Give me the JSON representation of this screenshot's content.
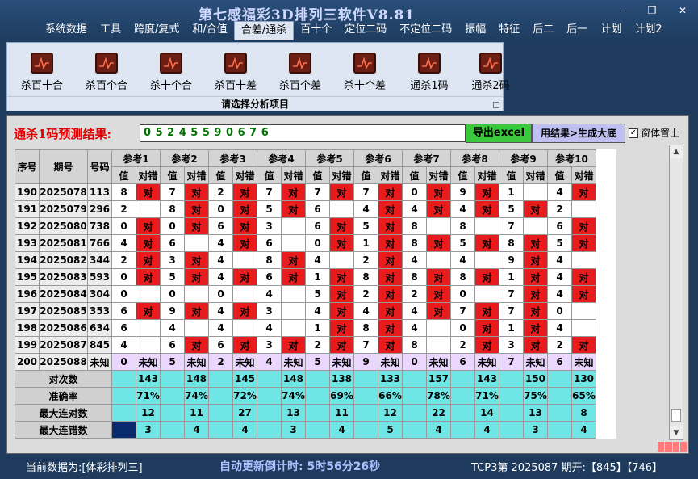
{
  "app": {
    "title": "第七感福彩3D排列三软件V8.81"
  },
  "window_controls": [
    "–",
    "❐",
    "✕"
  ],
  "menu": [
    "系统数据",
    "工具",
    "跨度/复式",
    "和/合值",
    "合差/通杀",
    "百十个",
    "定位二码",
    "不定位二码",
    "振幅",
    "特征",
    "后二",
    "后一",
    "计划",
    "计划2"
  ],
  "menu_active": 4,
  "ribbon": {
    "items": [
      "杀百十合",
      "杀百个合",
      "杀十个合",
      "杀百十差",
      "杀百个差",
      "杀十个差",
      "通杀1码",
      "通杀2码"
    ],
    "caption": "请选择分析项目"
  },
  "prediction": {
    "label": "通杀1码预测结果:",
    "value": "0 5 2 4 5 5 9 0 6 7 6",
    "excel_button": "导出excel",
    "generate_button": "用结果>生成大底",
    "topmost_label": "窗体置上",
    "topmost_checked": "✓"
  },
  "table": {
    "headers": {
      "seq": "序号",
      "period": "期号",
      "code": "号码"
    },
    "ref_groups": [
      "参考1",
      "参考2",
      "参考3",
      "参考4",
      "参考5",
      "参考6",
      "参考7",
      "参考8",
      "参考9",
      "参考10"
    ],
    "sub_headers": {
      "value": "值",
      "result": "对错"
    },
    "hit_text": "对",
    "unknown_text": "未知",
    "rows": [
      {
        "seq": "190",
        "period": "2025078",
        "code": "113",
        "vals": [
          "8",
          "7",
          "2",
          "7",
          "7",
          "7",
          "0",
          "9",
          "1",
          "4"
        ],
        "hits": [
          1,
          1,
          1,
          1,
          1,
          1,
          1,
          1,
          0,
          1
        ]
      },
      {
        "seq": "191",
        "period": "2025079",
        "code": "296",
        "vals": [
          "2",
          "8",
          "0",
          "5",
          "6",
          "4",
          "4",
          "4",
          "5",
          "2"
        ],
        "hits": [
          0,
          1,
          1,
          1,
          0,
          1,
          1,
          1,
          1,
          0
        ]
      },
      {
        "seq": "192",
        "period": "2025080",
        "code": "738",
        "vals": [
          "0",
          "0",
          "6",
          "3",
          "6",
          "5",
          "8",
          "8",
          "7",
          "6"
        ],
        "hits": [
          1,
          1,
          1,
          0,
          1,
          1,
          0,
          0,
          0,
          1
        ]
      },
      {
        "seq": "193",
        "period": "2025081",
        "code": "766",
        "vals": [
          "4",
          "6",
          "4",
          "6",
          "0",
          "1",
          "8",
          "5",
          "8",
          "5"
        ],
        "hits": [
          1,
          0,
          1,
          0,
          1,
          1,
          1,
          1,
          1,
          1
        ]
      },
      {
        "seq": "194",
        "period": "2025082",
        "code": "344",
        "vals": [
          "2",
          "3",
          "4",
          "8",
          "4",
          "2",
          "4",
          "4",
          "9",
          "4"
        ],
        "hits": [
          1,
          1,
          0,
          1,
          0,
          1,
          0,
          0,
          1,
          0
        ]
      },
      {
        "seq": "195",
        "period": "2025083",
        "code": "593",
        "vals": [
          "0",
          "5",
          "4",
          "6",
          "1",
          "8",
          "8",
          "8",
          "1",
          "4"
        ],
        "hits": [
          1,
          1,
          1,
          1,
          1,
          1,
          1,
          1,
          1,
          1
        ]
      },
      {
        "seq": "196",
        "period": "2025084",
        "code": "304",
        "vals": [
          "0",
          "0",
          "0",
          "4",
          "5",
          "2",
          "2",
          "0",
          "7",
          "4"
        ],
        "hits": [
          0,
          0,
          0,
          0,
          1,
          1,
          1,
          0,
          1,
          1
        ]
      },
      {
        "seq": "197",
        "period": "2025085",
        "code": "353",
        "vals": [
          "6",
          "9",
          "4",
          "3",
          "4",
          "4",
          "4",
          "7",
          "7",
          "0"
        ],
        "hits": [
          1,
          1,
          1,
          0,
          1,
          1,
          1,
          1,
          1,
          0
        ]
      },
      {
        "seq": "198",
        "period": "2025086",
        "code": "634",
        "vals": [
          "6",
          "4",
          "4",
          "4",
          "1",
          "8",
          "4",
          "0",
          "1",
          "4"
        ],
        "hits": [
          0,
          0,
          0,
          0,
          1,
          1,
          0,
          1,
          1,
          0
        ]
      },
      {
        "seq": "199",
        "period": "2025087",
        "code": "845",
        "vals": [
          "4",
          "6",
          "6",
          "3",
          "2",
          "7",
          "8",
          "2",
          "3",
          "2"
        ],
        "hits": [
          0,
          1,
          1,
          1,
          1,
          1,
          0,
          1,
          1,
          1
        ]
      }
    ],
    "pending": {
      "seq": "200",
      "period": "2025088",
      "code": "未知",
      "vals": [
        "0",
        "5",
        "2",
        "4",
        "5",
        "9",
        "0",
        "6",
        "7",
        "6"
      ]
    },
    "red_values": [
      [
        "2"
      ],
      [
        "2",
        "6",
        "2"
      ],
      [
        "0",
        "3",
        "8",
        "8",
        "7"
      ],
      [
        "6",
        "6"
      ],
      [
        "3",
        "4",
        "4",
        "4",
        "4",
        "4",
        "4"
      ],
      [
        "5"
      ],
      [
        "0",
        "0",
        "0",
        "4",
        "0"
      ],
      [
        "3"
      ],
      [
        "6",
        "4",
        "4",
        "4",
        "4",
        "4"
      ],
      [
        "4",
        "8"
      ]
    ],
    "stats": [
      {
        "label": "对次数",
        "values": [
          "143",
          "148",
          "145",
          "148",
          "138",
          "133",
          "157",
          "143",
          "150",
          "130"
        ]
      },
      {
        "label": "准确率",
        "values": [
          "71%",
          "74%",
          "72%",
          "74%",
          "69%",
          "66%",
          "78%",
          "71%",
          "75%",
          "65%"
        ]
      },
      {
        "label": "最大连对数",
        "values": [
          "12",
          "11",
          "27",
          "13",
          "11",
          "12",
          "22",
          "14",
          "13",
          "8"
        ]
      },
      {
        "label": "最大连错数",
        "values": [
          "3",
          "4",
          "4",
          "3",
          "4",
          "5",
          "4",
          "4",
          "3",
          "4"
        ]
      }
    ]
  },
  "status": {
    "left": "当前数据为:[体彩排列三]",
    "countdown": "自动更新倒计时: 5时56分26秒",
    "right": "TCP3第 2025087 期开:【845】【746】"
  }
}
